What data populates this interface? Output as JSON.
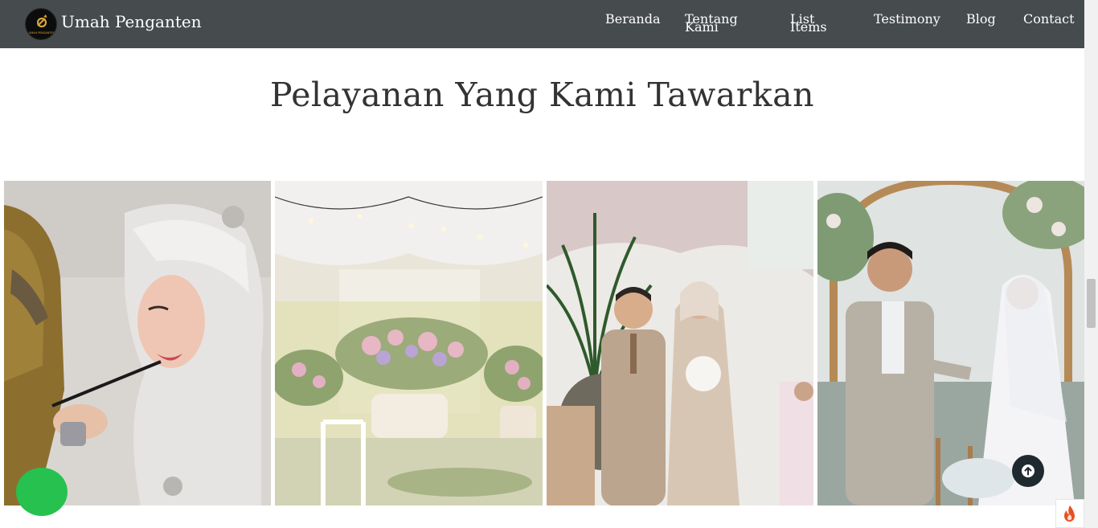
{
  "brand": {
    "name": "Umah Penganten",
    "logo_text": "UMAH PENGANTEN",
    "logo_icon": "ring-logo-icon"
  },
  "nav": {
    "beranda": "Beranda",
    "tentang_kami": "Tentang Kami",
    "list_items": "List Items",
    "testimony": "Testimony",
    "blog": "Blog",
    "contact": "Contact"
  },
  "section": {
    "title": "Pelayanan Yang Kami Tawarkan"
  },
  "gallery": [
    {
      "subject": "bridal makeup"
    },
    {
      "subject": "wedding decoration"
    },
    {
      "subject": "bride and groom walking"
    },
    {
      "subject": "ring exchange ceremony"
    }
  ],
  "floating": {
    "whatsapp_icon": "whatsapp-icon",
    "scroll_top_icon": "arrow-up-circle-icon",
    "fire_icon": "fire-icon"
  },
  "colors": {
    "navbar": "#464b4e",
    "heading": "#333333",
    "whatsapp": "#27c150",
    "scroll_top": "#1f2a30",
    "fire": "#e8501f"
  }
}
